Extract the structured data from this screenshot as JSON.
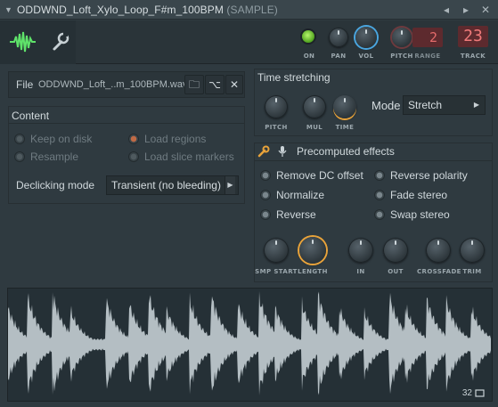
{
  "window": {
    "title": "ODDWND_Loft_Xylo_Loop_F#m_100BPM",
    "title_tag": "(SAMPLE)",
    "menu_glyph": "▼",
    "btn_menu": "◂",
    "btn_detach": "▸",
    "btn_close": "✕"
  },
  "toolbar": {
    "tabs": [
      {
        "name": "waveform-tab",
        "icon": "waveform-icon",
        "color": "#5fe36a"
      },
      {
        "name": "settings-tab",
        "icon": "wrench-icon"
      }
    ],
    "on_label": "ON",
    "pan_label": "PAN",
    "vol_label": "VOL",
    "pitch_label": "PITCH",
    "range_label": "RANGE",
    "range_value": "2",
    "track_label": "TRACK",
    "track_value": "23",
    "accent": "#4aa6e0"
  },
  "file": {
    "label": "File",
    "value": "ODDWND_Loft_..m_100BPM.wav",
    "open_icon": "folder-icon",
    "browse_icon": "tree-icon",
    "clear_icon": "close-icon",
    "open_glyph": "🗀",
    "browse_glyph": "⌥",
    "clear_glyph": "✕"
  },
  "content": {
    "title": "Content",
    "options": [
      {
        "label": "Keep on disk",
        "state": "disabled"
      },
      {
        "label": "Load regions",
        "state": "disabled-on"
      },
      {
        "label": "Resample",
        "state": "disabled"
      },
      {
        "label": "Load slice markers",
        "state": "disabled"
      }
    ],
    "declicking_label": "Declicking mode",
    "declicking_value": "Transient (no bleeding)"
  },
  "time_stretching": {
    "title": "Time stretching",
    "knobs": [
      "PITCH",
      "MUL",
      "TIME"
    ],
    "mode_label": "Mode",
    "mode_value": "Stretch"
  },
  "precomputed": {
    "title": "Precomputed effects",
    "options": [
      {
        "label": "Remove DC offset"
      },
      {
        "label": "Reverse polarity"
      },
      {
        "label": "Normalize"
      },
      {
        "label": "Fade stereo"
      },
      {
        "label": "Reverse"
      },
      {
        "label": "Swap stereo"
      }
    ],
    "knobs": [
      "SMP START",
      "LENGTH",
      "IN",
      "OUT",
      "CROSSFADE",
      "TRIM"
    ],
    "highlight": "#e9a33a"
  },
  "waveform": {
    "count": "32",
    "color": "#b4bec3"
  }
}
